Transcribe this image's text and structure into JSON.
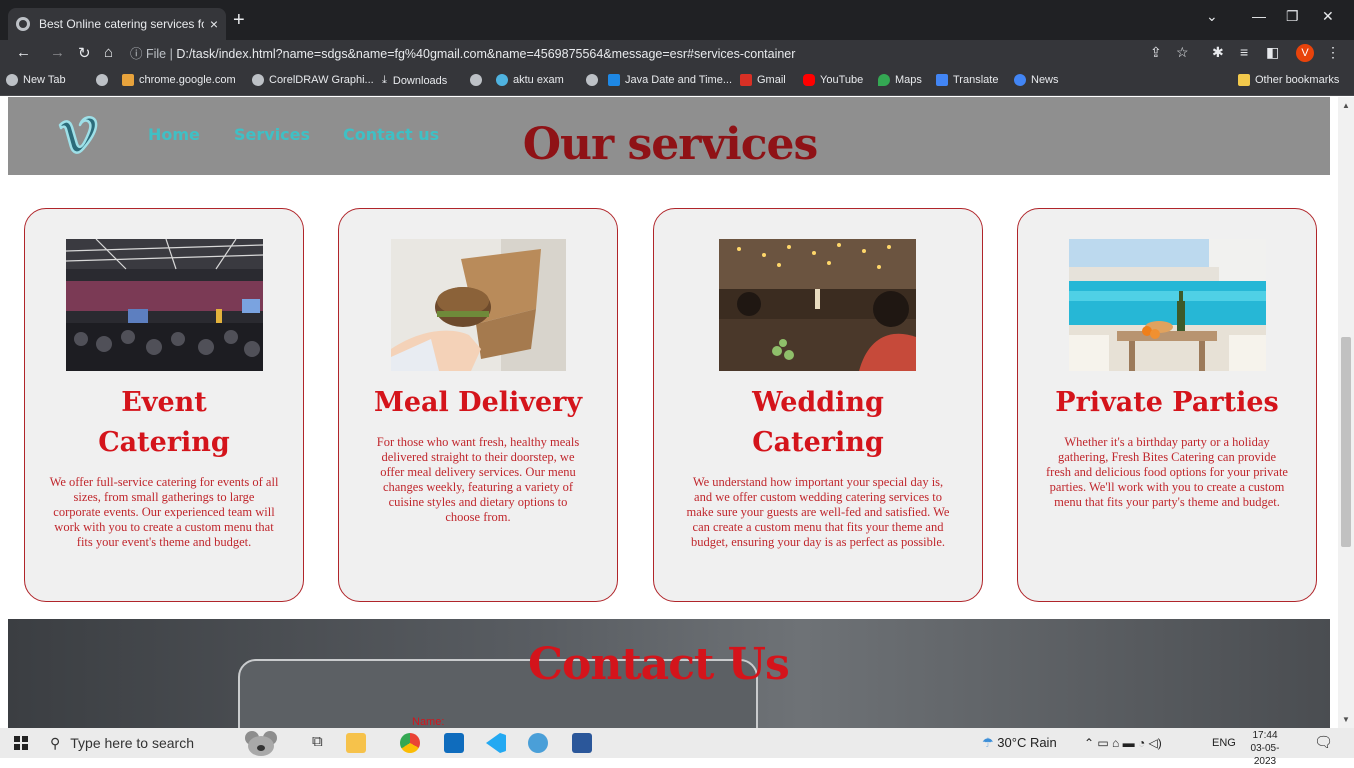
{
  "browser": {
    "tab_title": "Best Online catering services for",
    "tab_close": "×",
    "new_tab": "+",
    "url_info": "ⓘ File |",
    "url": "D:/task/index.html?name=sdgs&name=fg%40gmail.com&name=4569875564&message=esr#services-container",
    "profile_initial": "V",
    "bookmarks": [
      "New Tab",
      "chrome.google.com",
      "CorelDRAW Graphi...",
      "Downloads",
      "aktu exam",
      "Java Date and Time...",
      "Gmail",
      "YouTube",
      "Maps",
      "Translate",
      "News"
    ],
    "other_bookmarks": "Other bookmarks"
  },
  "page": {
    "nav": {
      "home": "Home",
      "services": "Services",
      "contact": "Contact us"
    },
    "services_title": "Our services",
    "cards": [
      {
        "title": "Event Catering",
        "text": "We offer full-service catering for events of all sizes, from small gatherings to large corporate events. Our experienced team will work with you to create a custom menu that fits your event's theme and budget."
      },
      {
        "title": "Meal Delivery",
        "text": "For those who want fresh, healthy meals delivered straight to their doorstep, we offer meal delivery services. Our menu changes weekly, featuring a variety of cuisine styles and dietary options to choose from."
      },
      {
        "title": "Wedding Catering",
        "text": "We understand how important your special day is, and we offer custom wedding catering services to make sure your guests are well-fed and satisfied. We can create a custom menu that fits your theme and budget, ensuring your day is as perfect as possible."
      },
      {
        "title": "Private Parties",
        "text": "Whether it's a birthday party or a holiday gathering, Fresh Bites Catering can provide fresh and delicious food options for your private parties. We'll work with you to create a custom menu that fits your party's theme and budget."
      }
    ],
    "contact_title": "Contact Us",
    "contact_peek": "Name:"
  },
  "taskbar": {
    "search_placeholder": "Type here to search",
    "weather": "30°C  Rain",
    "lang": "ENG",
    "time": "17:44",
    "date": "03-05-2023"
  },
  "colors": {
    "nav_link": "#3fc0c5",
    "title_dark": "#8f1216",
    "title_red": "#d4141b",
    "card_border": "#b0252a"
  }
}
